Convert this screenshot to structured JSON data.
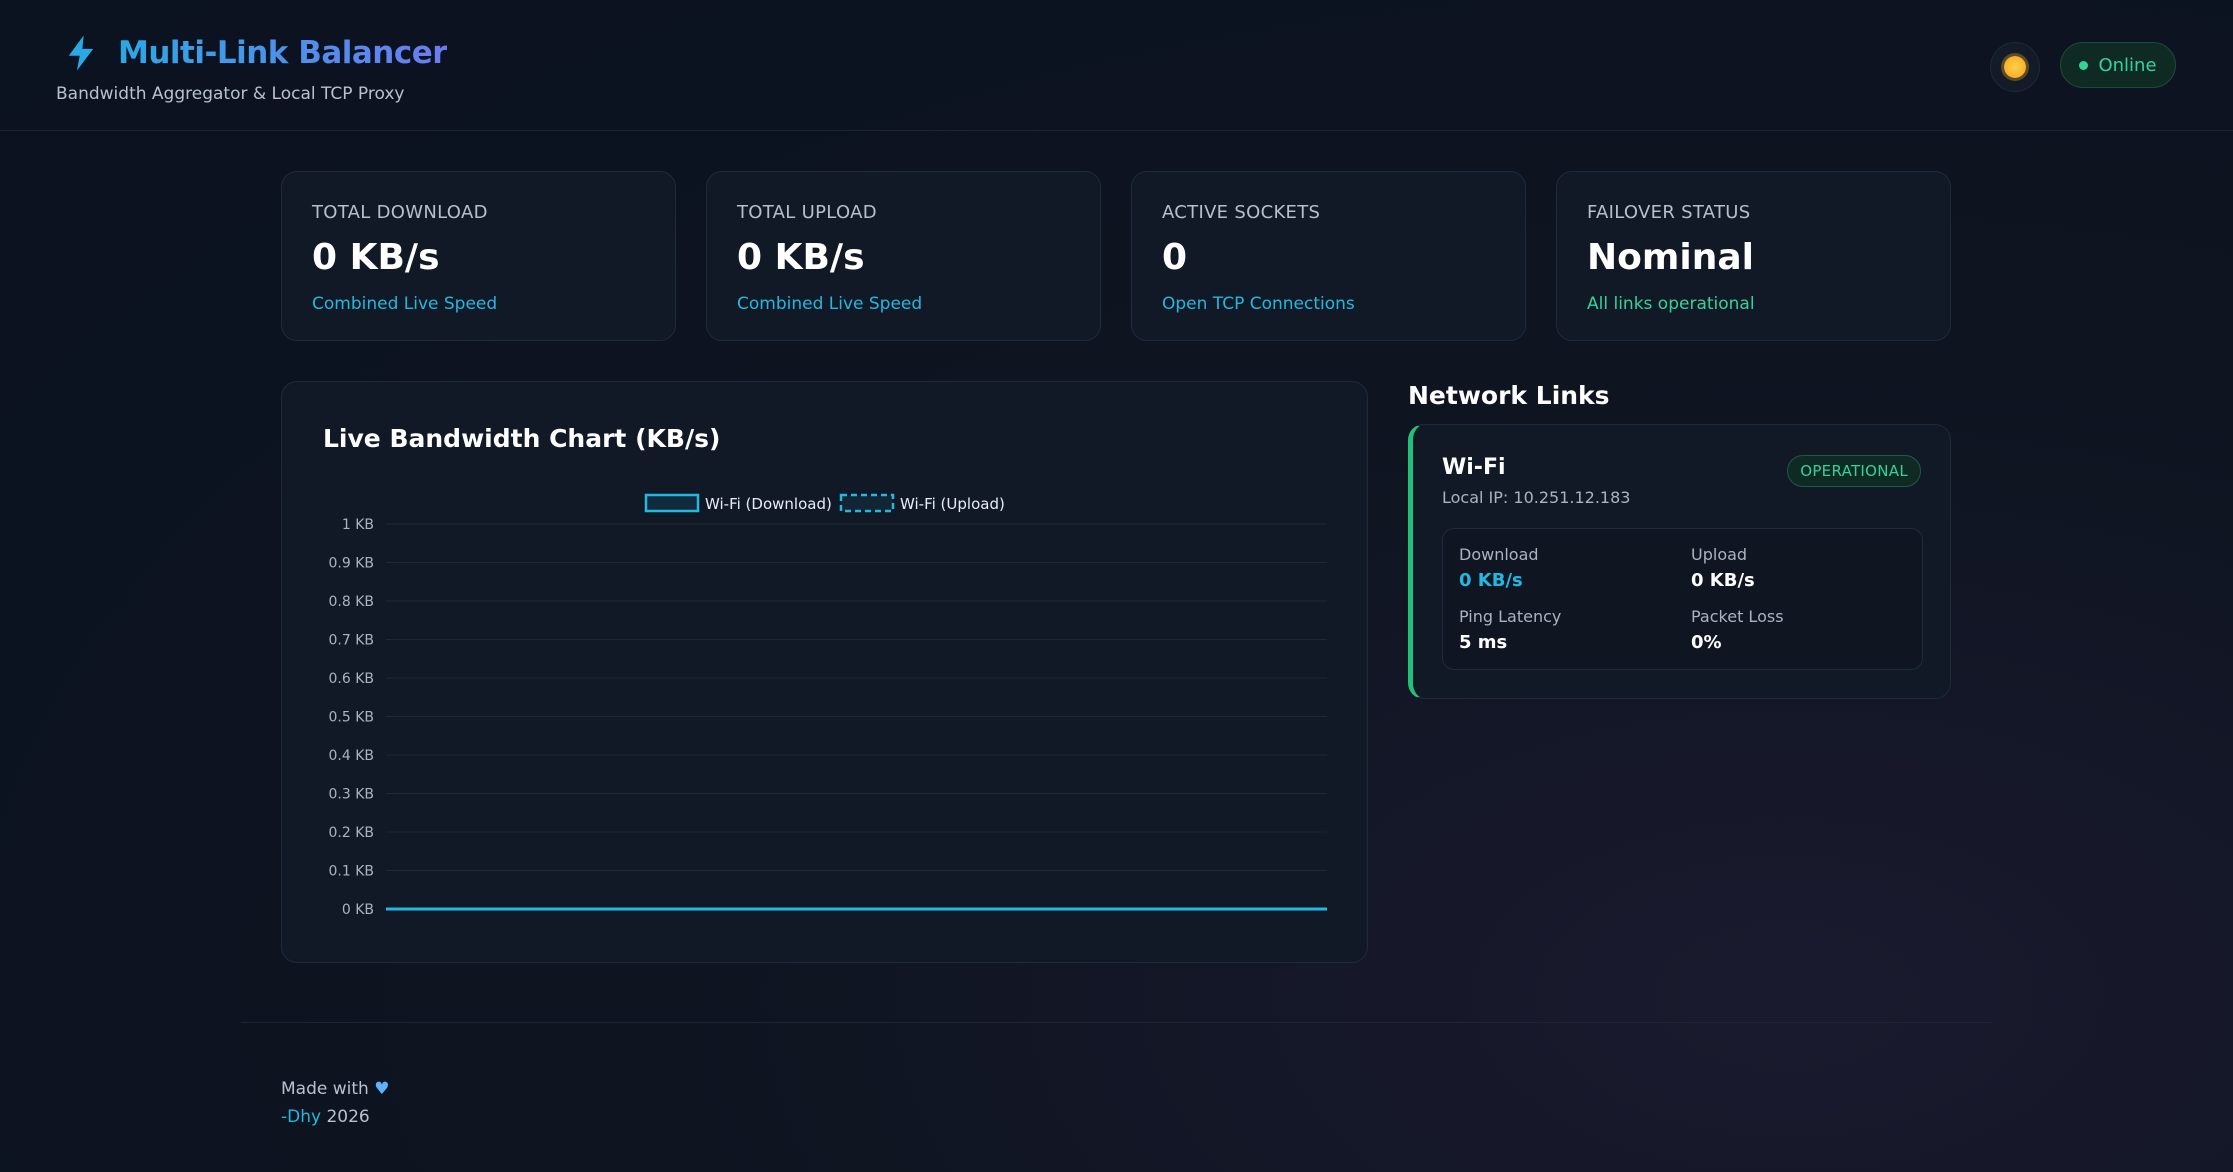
{
  "header": {
    "title": "Multi-Link Balancer",
    "subtitle": "Bandwidth Aggregator & Local TCP Proxy",
    "status": "Online"
  },
  "stats": [
    {
      "label": "TOTAL DOWNLOAD",
      "value": "0 KB/s",
      "foot": "Combined Live Speed"
    },
    {
      "label": "TOTAL UPLOAD",
      "value": "0 KB/s",
      "foot": "Combined Live Speed"
    },
    {
      "label": "ACTIVE SOCKETS",
      "value": "0",
      "foot": "Open TCP Connections"
    },
    {
      "label": "FAILOVER STATUS",
      "value": "Nominal",
      "foot": "All links operational"
    }
  ],
  "chart": {
    "title": "Live Bandwidth Chart (KB/s)"
  },
  "chart_data": {
    "type": "line",
    "title": "Live Bandwidth Chart (KB/s)",
    "yticks": [
      "1 KB",
      "0.9 KB",
      "0.8 KB",
      "0.7 KB",
      "0.6 KB",
      "0.5 KB",
      "0.4 KB",
      "0.3 KB",
      "0.2 KB",
      "0.1 KB",
      "0 KB"
    ],
    "ylim": [
      0,
      1
    ],
    "series": [
      {
        "name": "Wi-Fi (Download)",
        "style": "solid",
        "values": [
          0,
          0,
          0,
          0,
          0,
          0,
          0,
          0,
          0,
          0,
          0,
          0,
          0,
          0,
          0,
          0,
          0,
          0,
          0,
          0,
          0,
          0,
          0,
          0,
          0,
          0,
          0,
          0,
          0,
          0
        ]
      },
      {
        "name": "Wi-Fi (Upload)",
        "style": "dashed",
        "values": [
          0,
          0,
          0,
          0,
          0,
          0,
          0,
          0,
          0,
          0,
          0,
          0,
          0,
          0,
          0,
          0,
          0,
          0,
          0,
          0,
          0,
          0,
          0,
          0,
          0,
          0,
          0,
          0,
          0,
          0
        ]
      }
    ],
    "grid": true,
    "legend": "top-center",
    "color": "#22b8e0"
  },
  "network": {
    "title": "Network Links",
    "link": {
      "name": "Wi-Fi",
      "ip": "Local IP: 10.251.12.183",
      "badge": "OPERATIONAL",
      "download_label": "Download",
      "download_value": "0 KB/s",
      "upload_label": "Upload",
      "upload_value": "0 KB/s",
      "ping_label": "Ping Latency",
      "ping_value": "5 ms",
      "loss_label": "Packet Loss",
      "loss_value": "0%"
    }
  },
  "footer": {
    "made_with": "Made with",
    "author": "-Dhy",
    "year": "2026"
  },
  "colors": {
    "accent": "#22b8e0",
    "success": "#34d399"
  }
}
